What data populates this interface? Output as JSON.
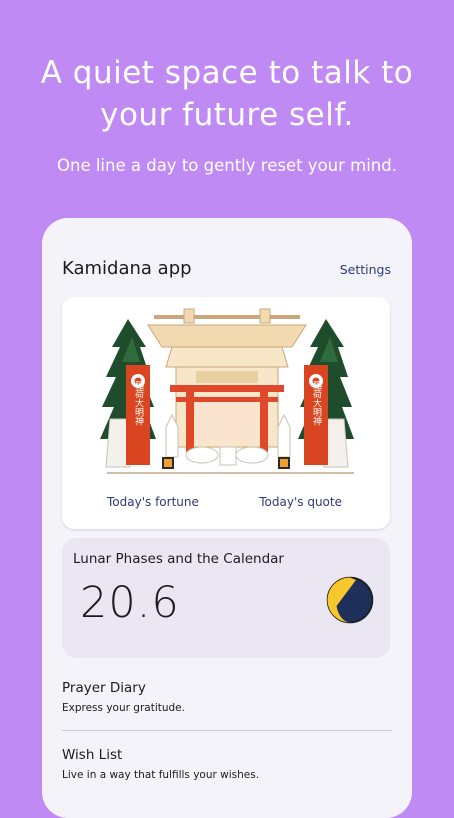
{
  "promo": {
    "title_line1": "A quiet space to talk to",
    "title_line2": "your future self.",
    "subtitle": "One line a day to gently reset your mind."
  },
  "app": {
    "title": "Kamidana app",
    "settings_label": "Settings"
  },
  "shrine_card": {
    "banner_text": "稲荷大明神",
    "fortune_label": "Today's fortune",
    "quote_label": "Today's quote"
  },
  "lunar": {
    "title": "Lunar Phases and the Calendar",
    "moon_age": "20.6",
    "moon_icon": "waning-gibbous-moon-icon"
  },
  "list": [
    {
      "title": "Prayer Diary",
      "subtitle": "Express your gratitude."
    },
    {
      "title": "Wish List",
      "subtitle": "Live in a way that fulfills your wishes."
    }
  ],
  "colors": {
    "background": "#c08af4",
    "link": "#2f3a78",
    "torii": "#e0482b",
    "moon_gold": "#f7c72b",
    "moon_dark": "#1e2f5a"
  }
}
